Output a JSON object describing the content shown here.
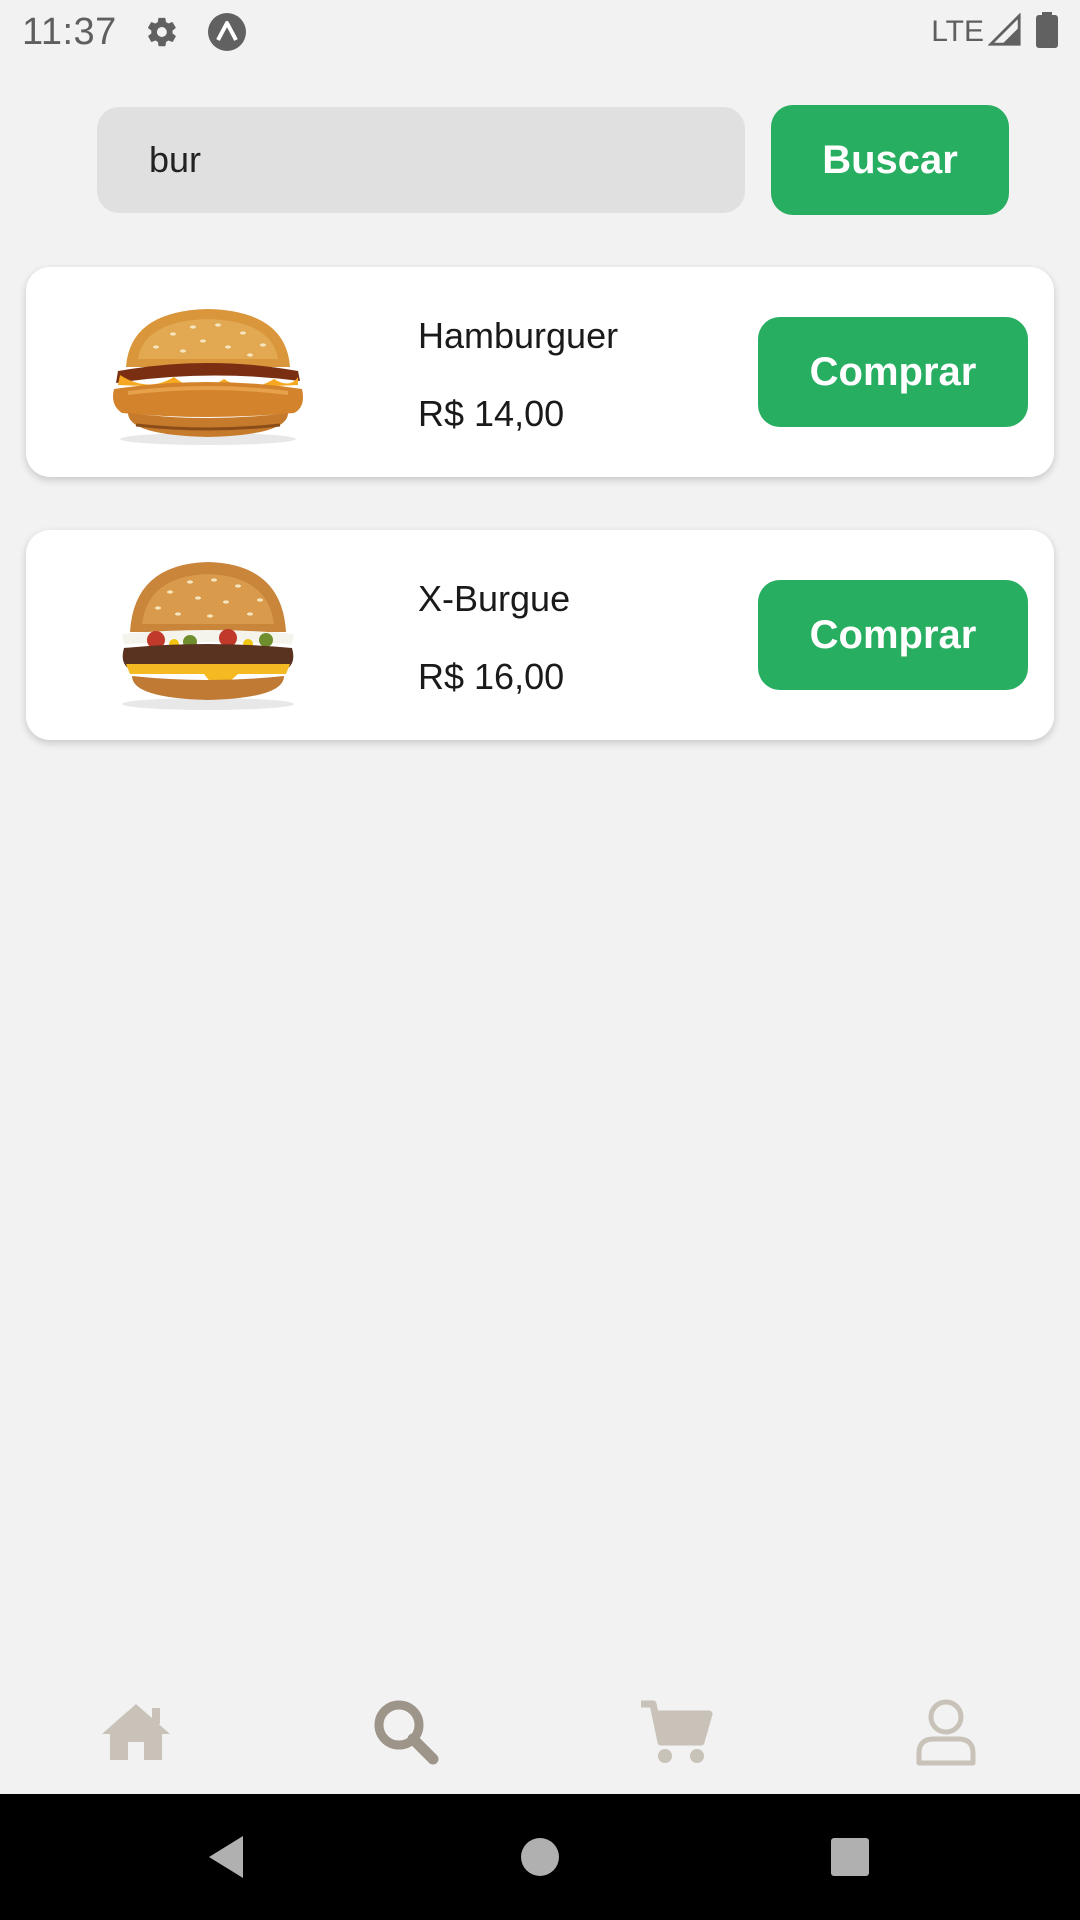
{
  "status_bar": {
    "time": "11:37",
    "network": "LTE",
    "icons": [
      "settings-gear-icon",
      "app-logo-icon",
      "signal-icon",
      "battery-icon"
    ]
  },
  "search": {
    "value": "bur",
    "button_label": "Buscar"
  },
  "products": [
    {
      "name": "Hamburguer",
      "price": "R$ 14,00",
      "button_label": "Comprar",
      "image": "chicken-burger-image"
    },
    {
      "name": "X-Burgue",
      "price": "R$ 16,00",
      "button_label": "Comprar",
      "image": "cheeseburger-image"
    }
  ],
  "bottom_nav": {
    "items": [
      "home-icon",
      "search-icon",
      "cart-icon",
      "profile-icon"
    ],
    "active": "search-icon"
  },
  "system_nav": [
    "back-icon",
    "home-circle-icon",
    "recents-icon"
  ],
  "colors": {
    "accent": "#27ae60",
    "background": "#f2f2f2",
    "input_bg": "#e0e0e0",
    "nav_icon": "#c8c2b8",
    "nav_icon_active": "#9e958a"
  }
}
